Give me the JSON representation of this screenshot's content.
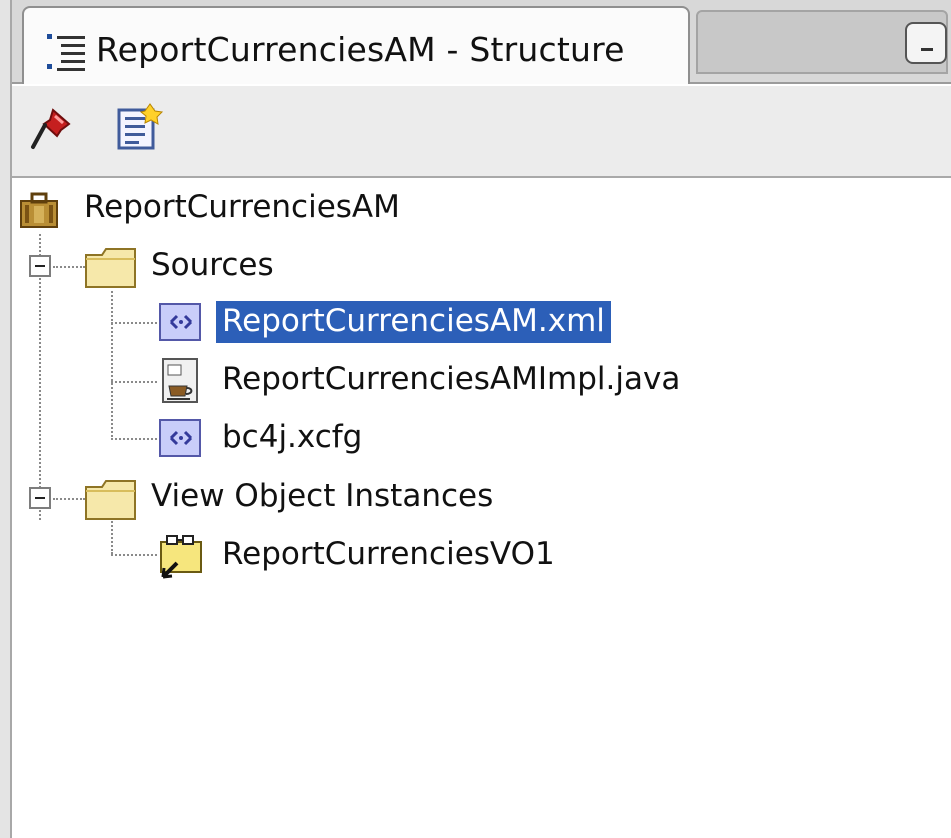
{
  "panel": {
    "title": "ReportCurrenciesAM - Structure"
  },
  "toolbar": {
    "pin_icon": "pin-icon",
    "edit_icon": "edit-properties-icon"
  },
  "tree": {
    "root": {
      "label": "ReportCurrenciesAM",
      "icon": "application-module-icon"
    },
    "sources": {
      "label": "Sources",
      "icon": "folder-icon",
      "expanded": true,
      "items": [
        {
          "label": "ReportCurrenciesAM.xml",
          "icon": "xml-file-icon",
          "selected": true
        },
        {
          "label": "ReportCurrenciesAMImpl.java",
          "icon": "java-file-icon",
          "selected": false
        },
        {
          "label": "bc4j.xcfg",
          "icon": "xml-file-icon",
          "selected": false
        }
      ]
    },
    "view_objects": {
      "label": "View Object Instances",
      "icon": "folder-icon",
      "expanded": true,
      "items": [
        {
          "label": "ReportCurrenciesVO1",
          "icon": "view-object-instance-icon",
          "selected": false
        }
      ]
    }
  },
  "colors": {
    "selection": "#2c5fb8",
    "folder": "#f4e3a0"
  }
}
